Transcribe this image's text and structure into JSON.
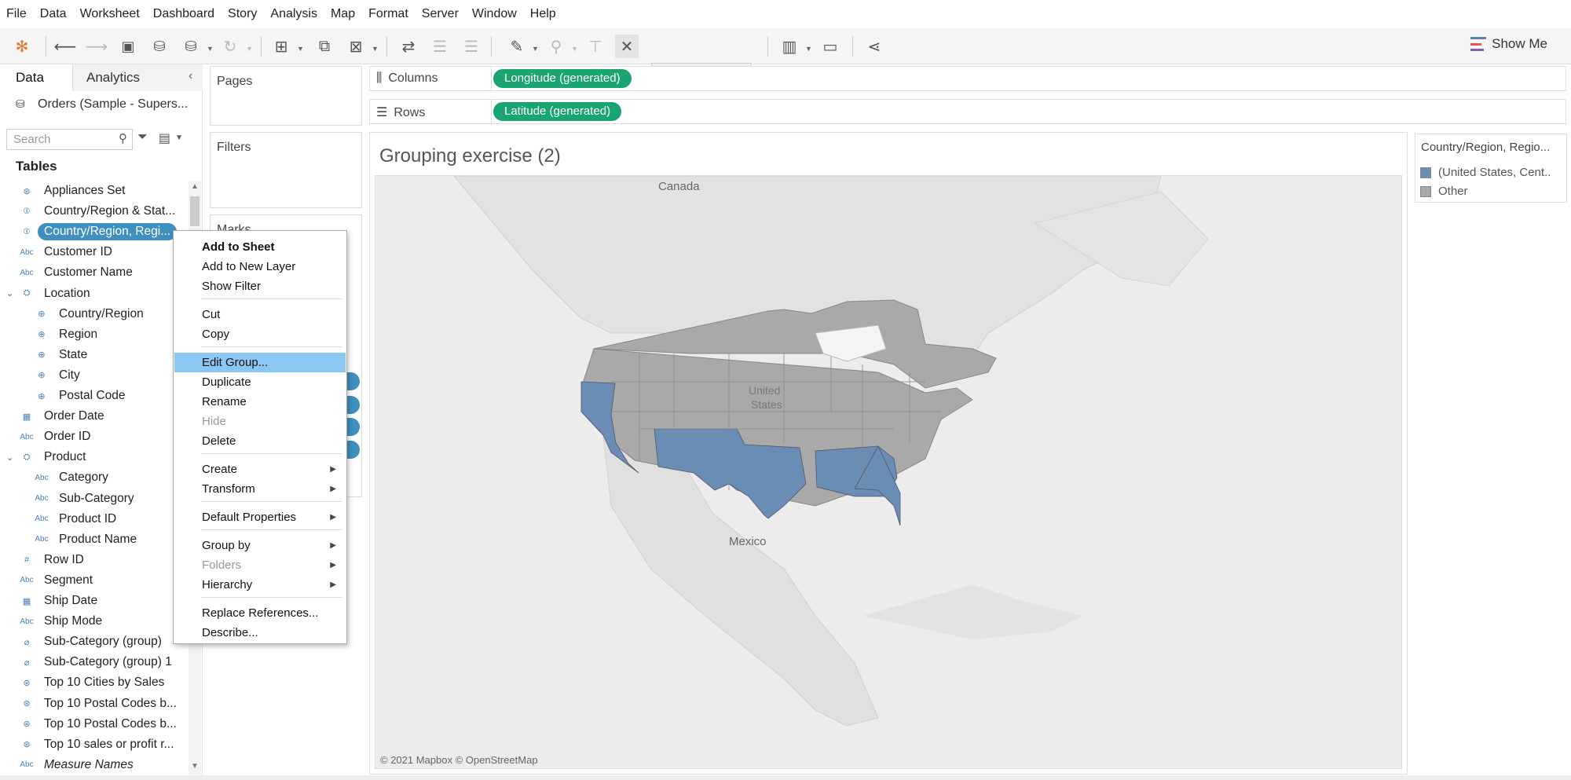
{
  "menu": [
    "File",
    "Data",
    "Worksheet",
    "Dashboard",
    "Story",
    "Analysis",
    "Map",
    "Format",
    "Server",
    "Window",
    "Help"
  ],
  "toolbar": {
    "show_me": "Show Me"
  },
  "left_panel": {
    "tab_data": "Data",
    "tab_analytics": "Analytics",
    "datasource": "Orders (Sample - Supers...",
    "search_placeholder": "Search",
    "tables_heading": "Tables",
    "fields": [
      {
        "label": "Appliances Set",
        "icon": "set-icon"
      },
      {
        "label": "Country/Region & Stat...",
        "icon": "group-icon"
      },
      {
        "label": "Country/Region, Regi...",
        "icon": "group-icon"
      },
      {
        "label": "Customer ID",
        "icon": "abc-icon"
      },
      {
        "label": "Customer Name",
        "icon": "abc-icon"
      },
      {
        "label": "Location",
        "icon": "hierarchy-icon"
      },
      {
        "label": "Country/Region",
        "icon": "globe-icon"
      },
      {
        "label": "Region",
        "icon": "globe-icon"
      },
      {
        "label": "State",
        "icon": "globe-icon"
      },
      {
        "label": "City",
        "icon": "globe-icon"
      },
      {
        "label": "Postal Code",
        "icon": "globe-icon"
      },
      {
        "label": "Order Date",
        "icon": "calendar-icon"
      },
      {
        "label": "Order ID",
        "icon": "abc-icon"
      },
      {
        "label": "Product",
        "icon": "hierarchy-icon"
      },
      {
        "label": "Category",
        "icon": "abc-icon"
      },
      {
        "label": "Sub-Category",
        "icon": "abc-icon"
      },
      {
        "label": "Product ID",
        "icon": "abc-icon"
      },
      {
        "label": "Product Name",
        "icon": "abc-icon"
      },
      {
        "label": "Row ID",
        "icon": "number-icon"
      },
      {
        "label": "Segment",
        "icon": "abc-icon"
      },
      {
        "label": "Ship Date",
        "icon": "calendar-icon"
      },
      {
        "label": "Ship Mode",
        "icon": "abc-icon"
      },
      {
        "label": "Sub-Category (group)",
        "icon": "paperclip-icon"
      },
      {
        "label": "Sub-Category (group) 1",
        "icon": "paperclip-icon"
      },
      {
        "label": "Top 10 Cities by Sales",
        "icon": "set-icon"
      },
      {
        "label": "Top 10 Postal Codes b...",
        "icon": "set-icon"
      },
      {
        "label": "Top 10 Postal Codes b...",
        "icon": "set-icon"
      },
      {
        "label": "Top 10 sales or profit r...",
        "icon": "set-icon"
      },
      {
        "label": "Measure Names",
        "icon": "abc-icon"
      }
    ]
  },
  "shelves": {
    "pages": "Pages",
    "filters": "Filters",
    "marks": "Marks",
    "columns_label": "Columns",
    "rows_label": "Rows",
    "columns_pill": "Longitude (generated)",
    "rows_pill": "Latitude (generated)"
  },
  "viz": {
    "title": "Grouping exercise (2)",
    "labels": {
      "canada": "Canada",
      "united_states": "United\nStates",
      "mexico": "Mexico"
    },
    "copyright": "© 2021 Mapbox © OpenStreetMap"
  },
  "legend": {
    "title": "Country/Region, Regio...",
    "items": [
      {
        "label": "(United States, Cent..",
        "color": "#6a8db5"
      },
      {
        "label": "Other",
        "color": "#a9a9a9"
      }
    ]
  },
  "context_menu": {
    "items": [
      {
        "label": "Add to Sheet",
        "bold": true
      },
      {
        "label": "Add to New Layer"
      },
      {
        "label": "Show Filter"
      },
      {
        "label": "Cut"
      },
      {
        "label": "Copy"
      },
      {
        "label": "Edit Group...",
        "highlighted": true
      },
      {
        "label": "Duplicate"
      },
      {
        "label": "Rename"
      },
      {
        "label": "Hide",
        "disabled": true
      },
      {
        "label": "Delete"
      },
      {
        "label": "Create",
        "submenu": true
      },
      {
        "label": "Transform",
        "submenu": true
      },
      {
        "label": "Default Properties",
        "submenu": true
      },
      {
        "label": "Group by",
        "submenu": true
      },
      {
        "label": "Folders",
        "submenu": true,
        "disabled": true
      },
      {
        "label": "Hierarchy",
        "submenu": true
      },
      {
        "label": "Replace References..."
      },
      {
        "label": "Describe..."
      }
    ]
  },
  "colors": {
    "group_blue": "#6a8db5",
    "other_gray": "#a9a9a9",
    "pill_green": "#1aa470",
    "highlight": "#8cc6f2"
  }
}
